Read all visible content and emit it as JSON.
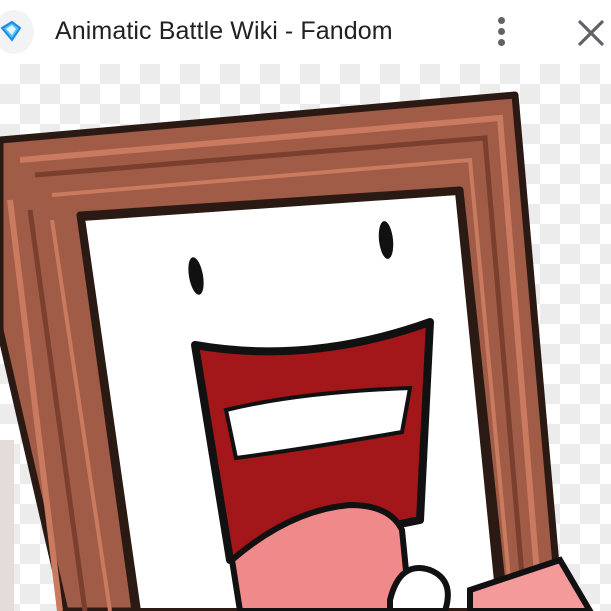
{
  "header": {
    "title": "Animatic Battle Wiki - Fandom",
    "site_icon": "fandom-logo-icon",
    "more_icon": "more-vert-icon",
    "close_icon": "close-icon"
  },
  "image": {
    "subject": "cartoon-picture-frame-character",
    "background": "transparency-checkerboard"
  },
  "colors": {
    "frame_brown": "#9c5a45",
    "frame_dark": "#6b3a2b",
    "mouth_red": "#a3161a",
    "tongue_pink": "#f08a8a",
    "icon_gray": "#5f6368"
  }
}
